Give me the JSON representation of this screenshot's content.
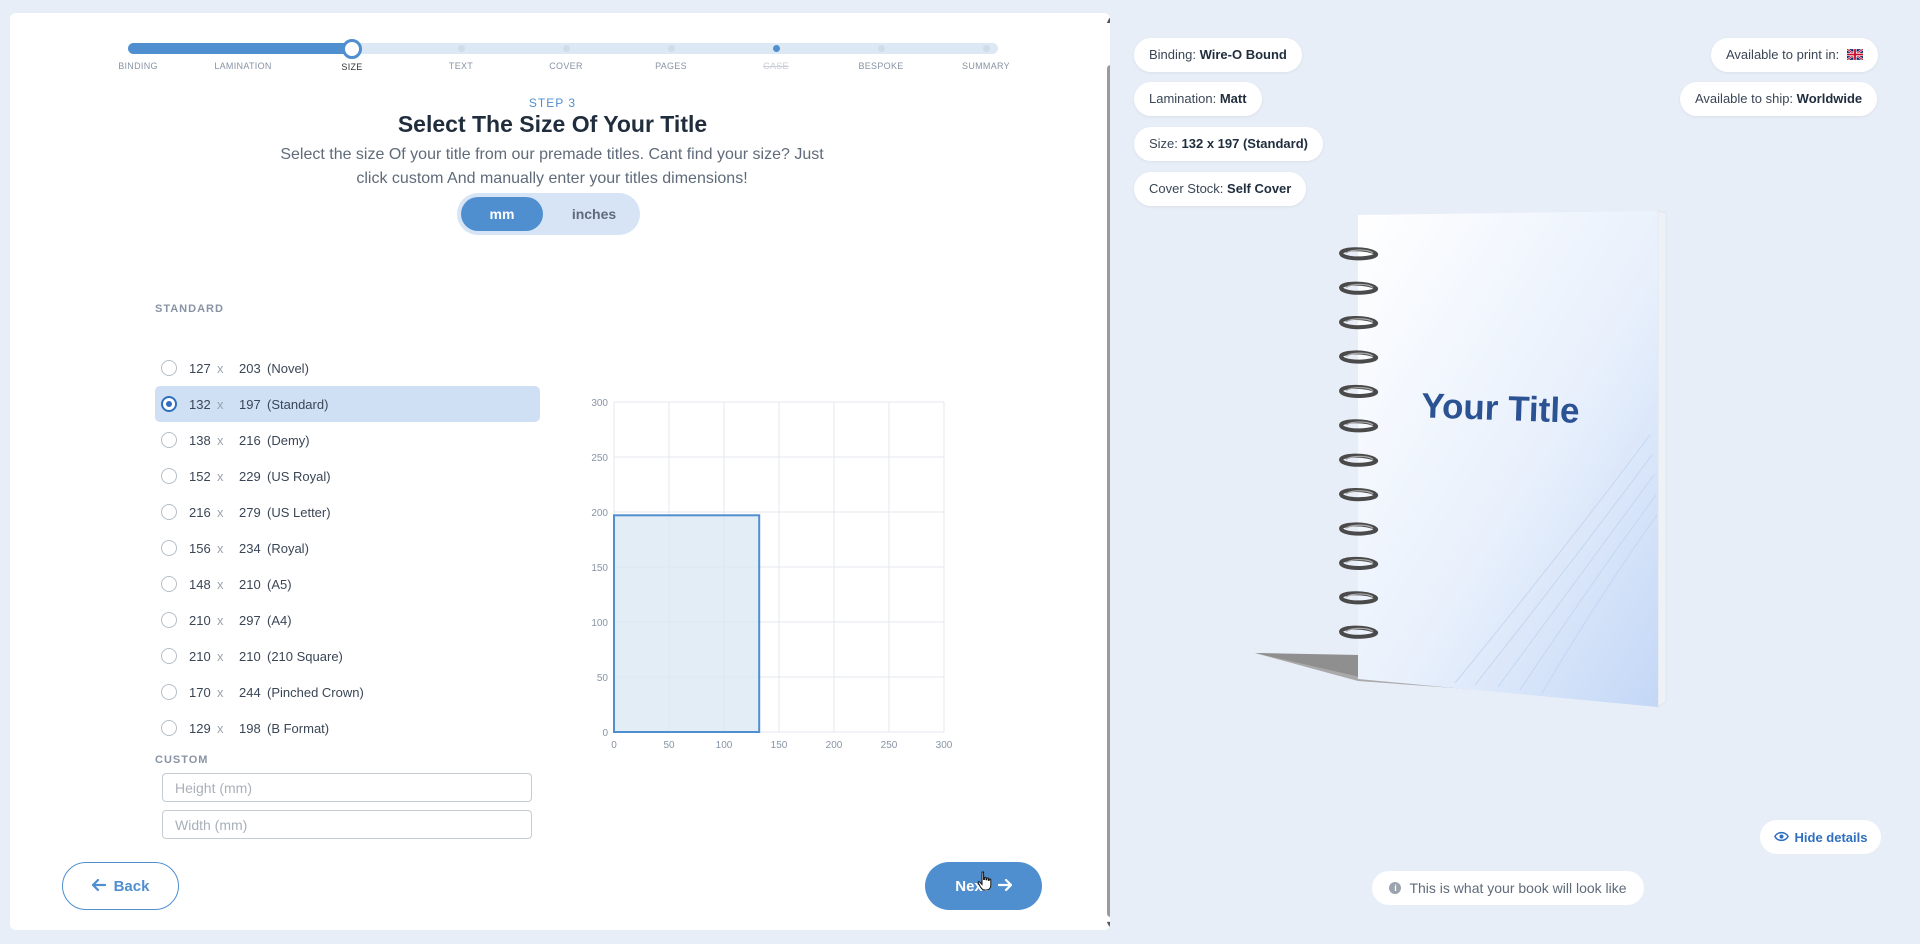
{
  "stepper": {
    "steps": [
      {
        "label": "BINDING",
        "state": "done"
      },
      {
        "label": "LAMINATION",
        "state": "done"
      },
      {
        "label": "SIZE",
        "state": "current"
      },
      {
        "label": "TEXT",
        "state": "future"
      },
      {
        "label": "COVER",
        "state": "future"
      },
      {
        "label": "PAGES",
        "state": "future"
      },
      {
        "label": "CASE",
        "state": "disabled"
      },
      {
        "label": "BESPOKE",
        "state": "future"
      },
      {
        "label": "SUMMARY",
        "state": "future"
      }
    ]
  },
  "header": {
    "step_label": "STEP 3",
    "title": "Select The Size Of Your Title",
    "subtitle": "Select the size Of your title from our premade titles. Cant find your size? Just click custom And manually enter your titles dimensions!"
  },
  "units": {
    "mm": "mm",
    "inches": "inches",
    "selected": "mm"
  },
  "standard": {
    "label": "STANDARD",
    "separator": "x",
    "selected_index": 1,
    "sizes": [
      {
        "w": "127",
        "h": "203",
        "name": "(Novel)"
      },
      {
        "w": "132",
        "h": "197",
        "name": "(Standard)"
      },
      {
        "w": "138",
        "h": "216",
        "name": "(Demy)"
      },
      {
        "w": "152",
        "h": "229",
        "name": "(US Royal)"
      },
      {
        "w": "216",
        "h": "279",
        "name": "(US Letter)"
      },
      {
        "w": "156",
        "h": "234",
        "name": "(Royal)"
      },
      {
        "w": "148",
        "h": "210",
        "name": "(A5)"
      },
      {
        "w": "210",
        "h": "297",
        "name": "(A4)"
      },
      {
        "w": "210",
        "h": "210",
        "name": "(210 Square)"
      },
      {
        "w": "170",
        "h": "244",
        "name": "(Pinched Crown)"
      },
      {
        "w": "129",
        "h": "198",
        "name": "(B Format)"
      }
    ]
  },
  "custom": {
    "label": "CUSTOM",
    "height_placeholder": "Height (mm)",
    "width_placeholder": "Width (mm)"
  },
  "chart_data": {
    "type": "area",
    "xlim": [
      0,
      300
    ],
    "ylim": [
      0,
      300
    ],
    "x_ticks": [
      0,
      50,
      100,
      150,
      200,
      250,
      300
    ],
    "y_ticks": [
      0,
      50,
      100,
      150,
      200,
      250,
      300
    ],
    "rect": {
      "width": 132,
      "height": 197
    },
    "grid": true,
    "fill_color": "#dbe8f4",
    "stroke_color": "#4f8fd0"
  },
  "nav": {
    "back": "Back",
    "next": "Next"
  },
  "details": {
    "binding": {
      "label": "Binding:",
      "value": "Wire-O Bound"
    },
    "lamination": {
      "label": "Lamination:",
      "value": "Matt"
    },
    "size": {
      "label": "Size:",
      "value": "132 x 197 (Standard)"
    },
    "cover_stock": {
      "label": "Cover Stock:",
      "value": "Self Cover"
    },
    "print": {
      "label": "Available to print in:"
    },
    "ship": {
      "label": "Available to ship:",
      "value": "Worldwide"
    }
  },
  "preview": {
    "book_title": "Your Title",
    "hide_details": "Hide details",
    "note": "This is what your book will look like"
  },
  "colors": {
    "accent": "#4f8fd0",
    "background": "#e8eef8"
  }
}
